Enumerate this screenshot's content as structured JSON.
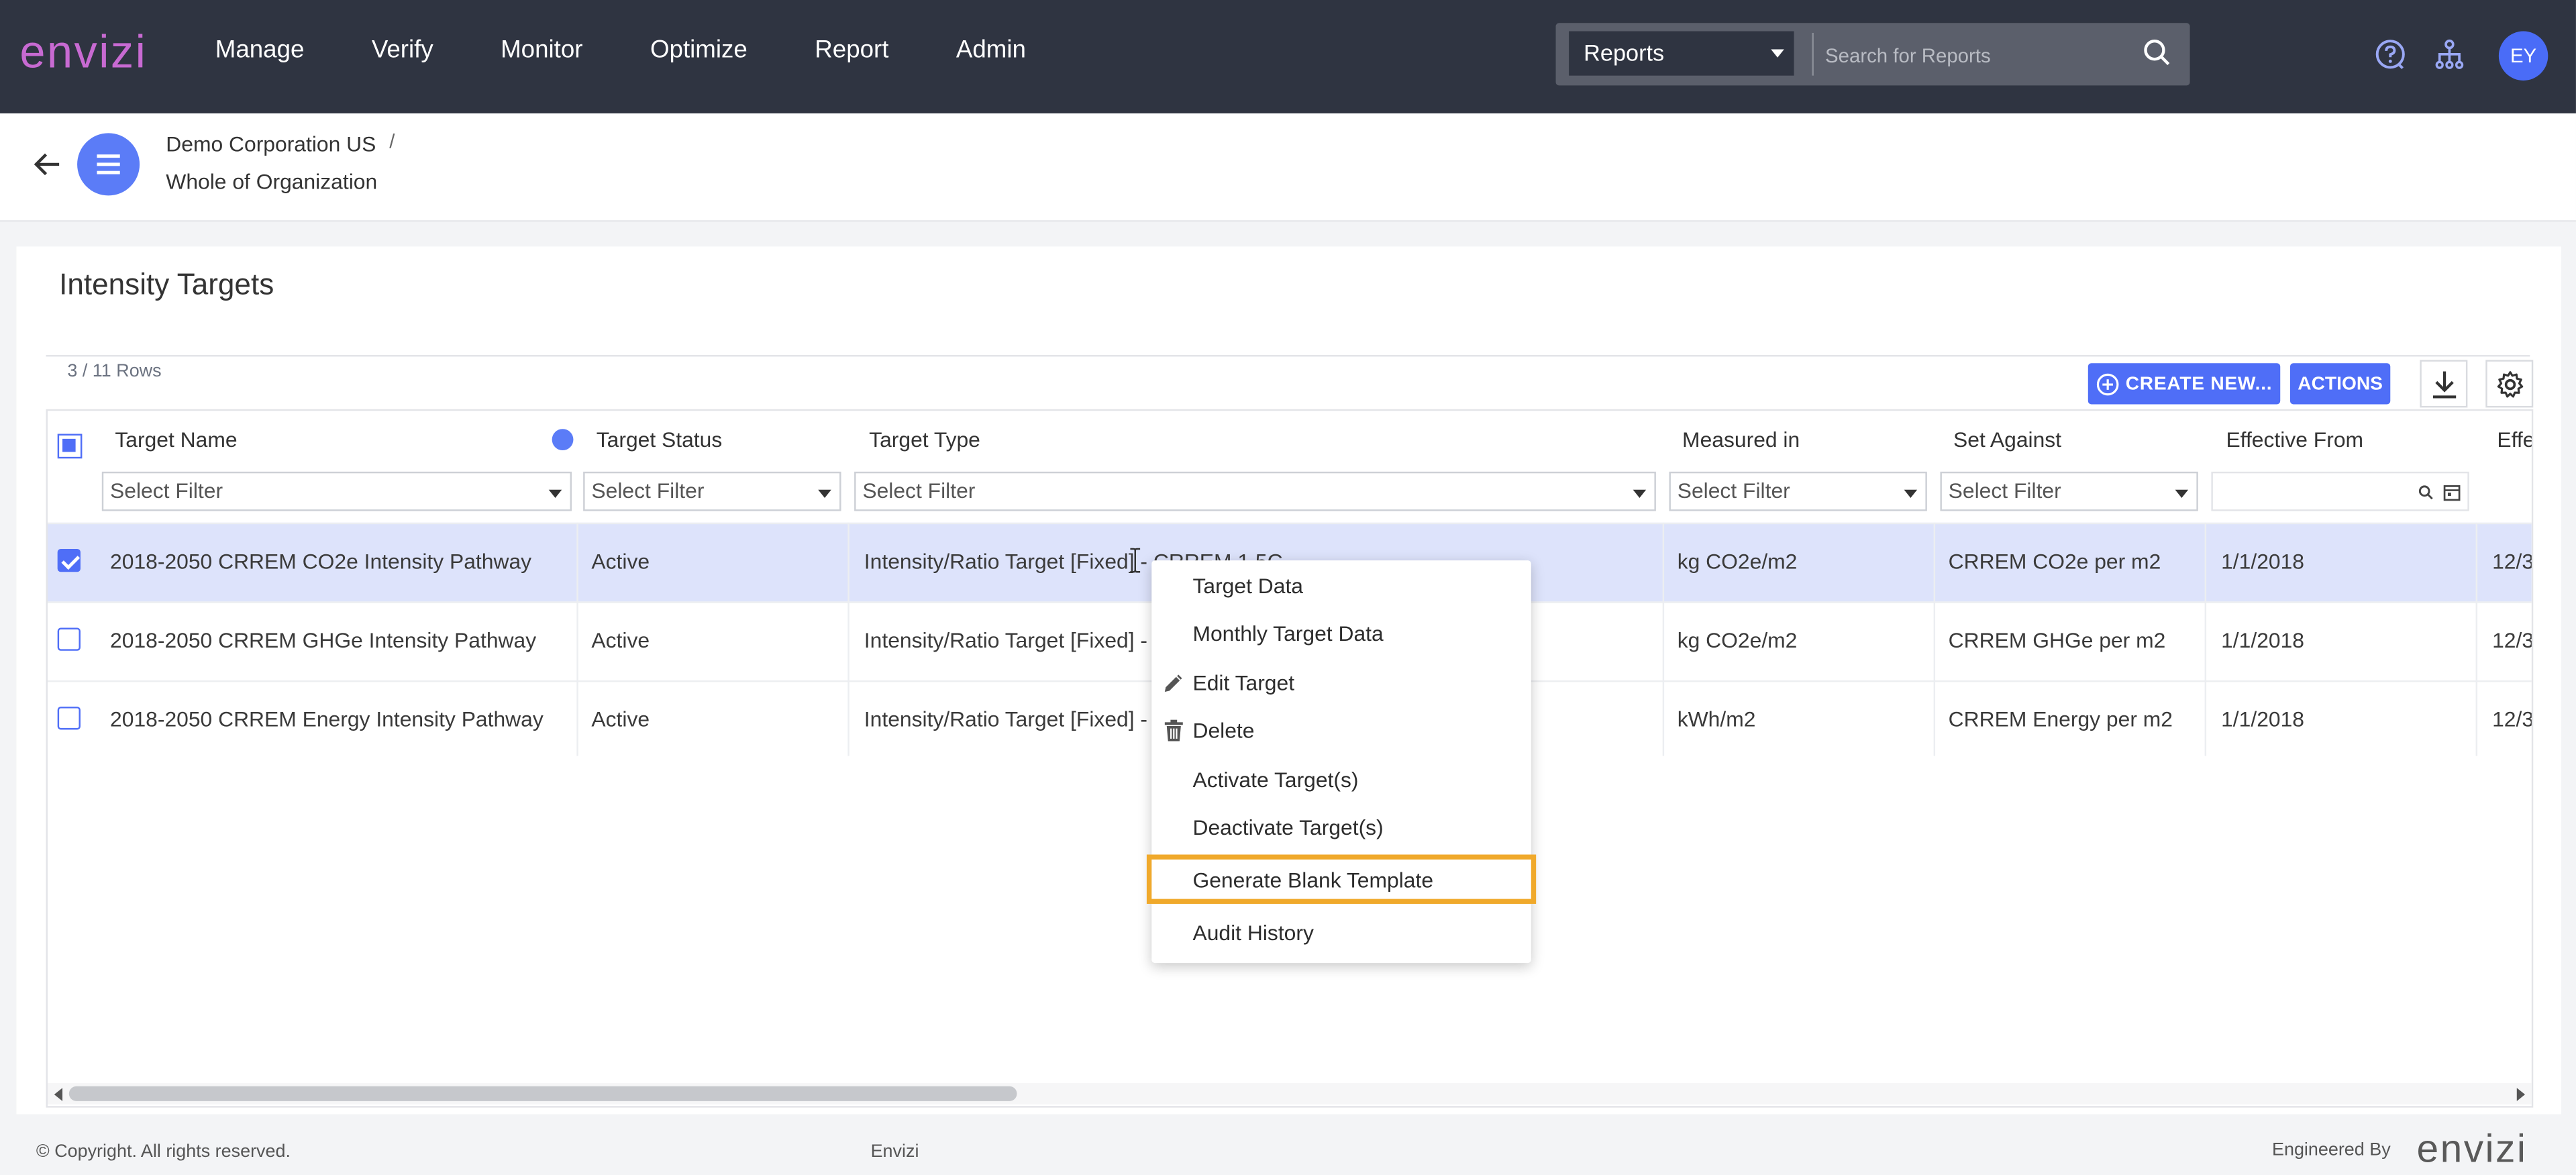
{
  "header": {
    "logo": "envizi",
    "nav": [
      "Manage",
      "Verify",
      "Monitor",
      "Optimize",
      "Report",
      "Admin"
    ],
    "search_scope": "Reports",
    "search_placeholder": "Search for Reports",
    "avatar_initials": "EY"
  },
  "breadcrumb": {
    "org": "Demo Corporation US",
    "separator": "/",
    "location": "Whole of Organization"
  },
  "page": {
    "title": "Intensity Targets",
    "row_count": "3 / 11 Rows",
    "create_button": "CREATE NEW...",
    "actions_button": "ACTIONS"
  },
  "grid": {
    "columns": [
      "Target Name",
      "Target Status",
      "Target Type",
      "Measured in",
      "Set Against",
      "Effective From",
      "Effe"
    ],
    "filter_placeholder": "Select Filter",
    "rows": [
      {
        "name": "2018-2050 CRREM CO2e Intensity Pathway",
        "status": "Active",
        "type": "Intensity/Ratio Target [Fixed] - CRREM 1.5C",
        "measured": "kg CO2e/m2",
        "against": "CRREM CO2e per m2",
        "from": "1/1/2018",
        "to": "12/3"
      },
      {
        "name": "2018-2050 CRREM GHGe Intensity Pathway",
        "status": "Active",
        "type": "Intensity/Ratio Target [Fixed] -",
        "measured": "kg CO2e/m2",
        "against": "CRREM GHGe per m2",
        "from": "1/1/2018",
        "to": "12/3"
      },
      {
        "name": "2018-2050 CRREM Energy Intensity Pathway",
        "status": "Active",
        "type": "Intensity/Ratio Target [Fixed] -",
        "measured": "kWh/m2",
        "against": "CRREM Energy per m2",
        "from": "1/1/2018",
        "to": "12/3"
      }
    ]
  },
  "context_menu": {
    "items": [
      "Target Data",
      "Monthly Target Data",
      "Edit Target",
      "Delete",
      "Activate Target(s)",
      "Deactivate Target(s)",
      "Generate Blank Template",
      "Audit History"
    ]
  },
  "footer": {
    "copyright": "© Copyright. All rights reserved.",
    "middle": "Envizi",
    "engineered_by": "Engineered By",
    "logo": "envizi"
  },
  "colors": {
    "topbar": "#2f3441",
    "accent": "#4f6ef7",
    "highlight": "#f0a92b",
    "selected_row": "#dde3fb"
  }
}
